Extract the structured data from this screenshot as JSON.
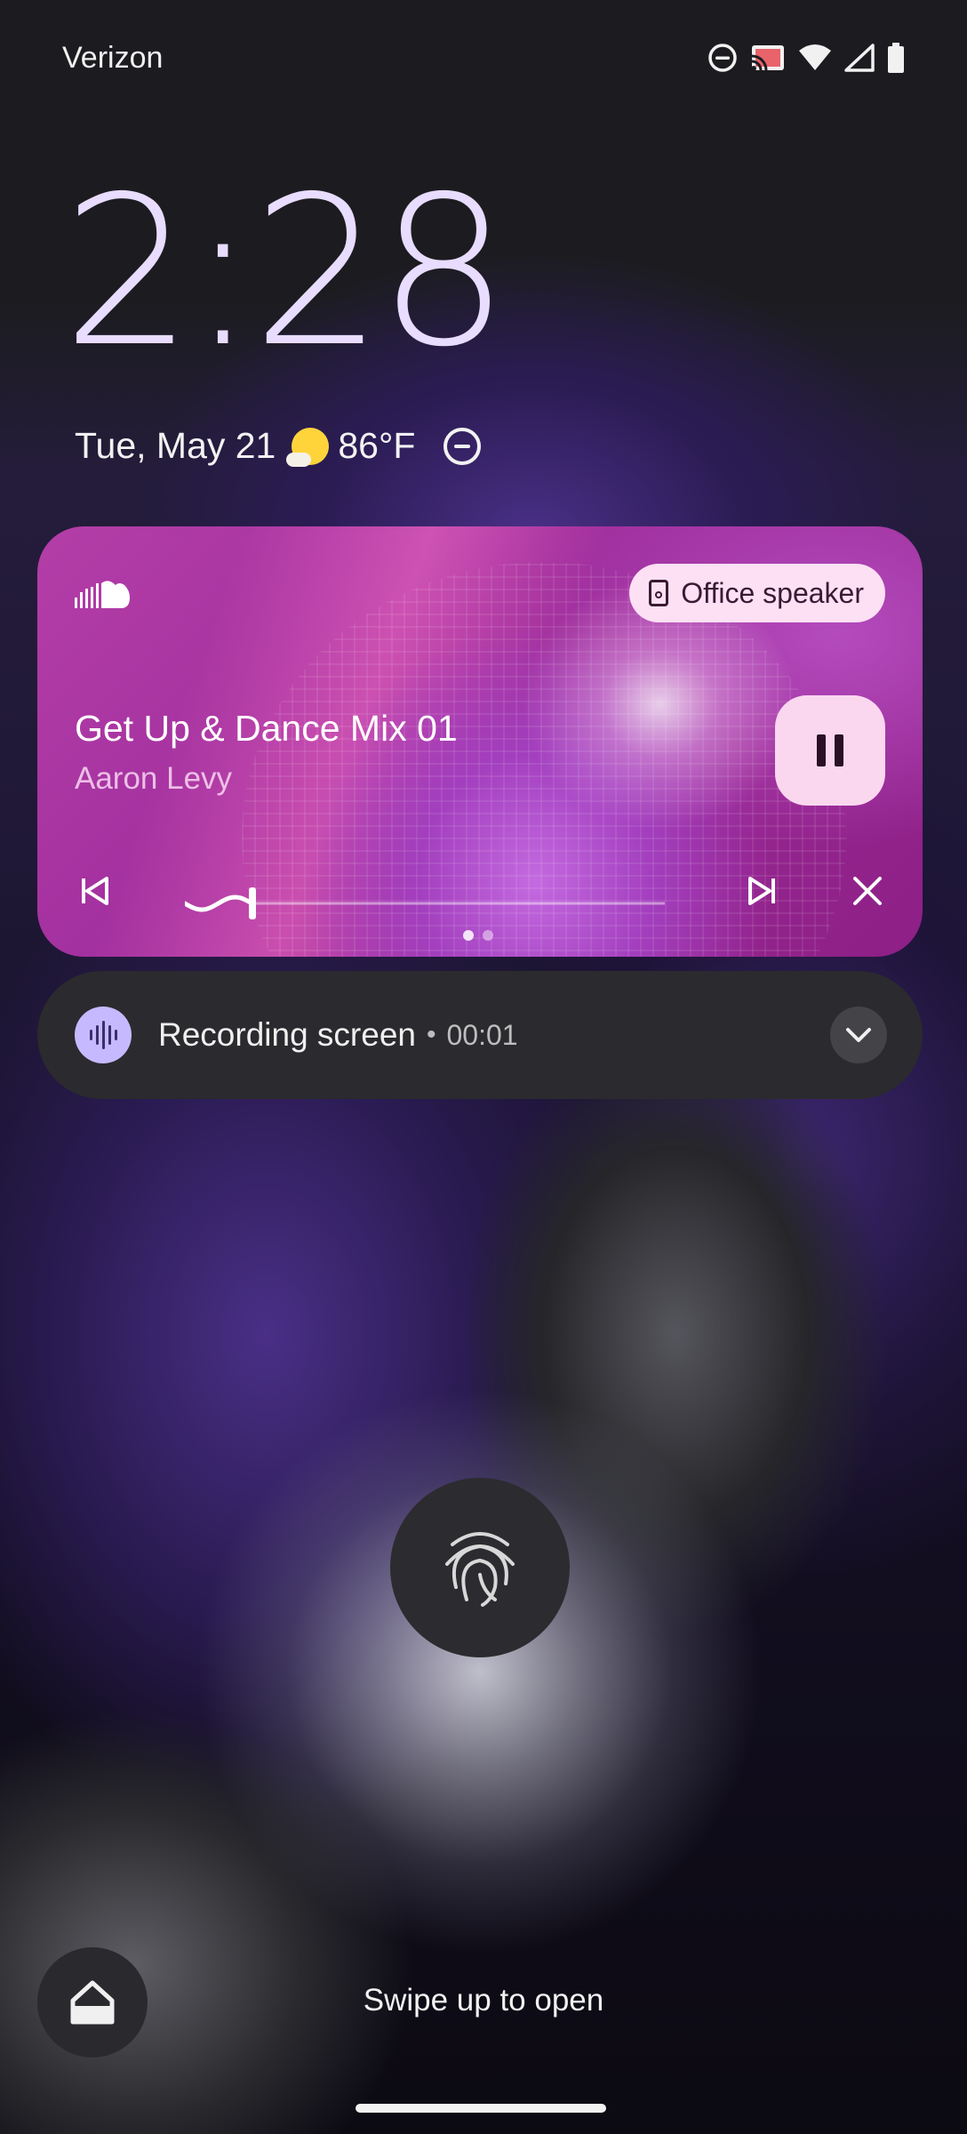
{
  "status_bar": {
    "carrier": "Verizon",
    "icons": [
      "dnd-icon",
      "cast-icon",
      "wifi-icon",
      "signal-icon",
      "battery-icon"
    ]
  },
  "lockscreen": {
    "time": "2:28",
    "date": "Tue, May 21",
    "weather_icon": "partly-sunny-icon",
    "temperature": "86°F"
  },
  "media": {
    "app_icon": "soundcloud-icon",
    "output_device": "Office speaker",
    "title": "Get Up & Dance Mix 01",
    "artist": "Aaron Levy",
    "progress": 0.14,
    "page_count": 2,
    "current_page": 1,
    "colors": {
      "card": "#a8339f",
      "pause_bg": "#fbd7ef",
      "chip_bg": "#fde0f4"
    }
  },
  "notification": {
    "title": "Recording screen",
    "separator": "•",
    "time": "00:01",
    "icon": "sound-wave-icon"
  },
  "bottom": {
    "hint": "Swipe up to open",
    "home_icon": "home-icon",
    "fingerprint_icon": "fingerprint-icon"
  }
}
